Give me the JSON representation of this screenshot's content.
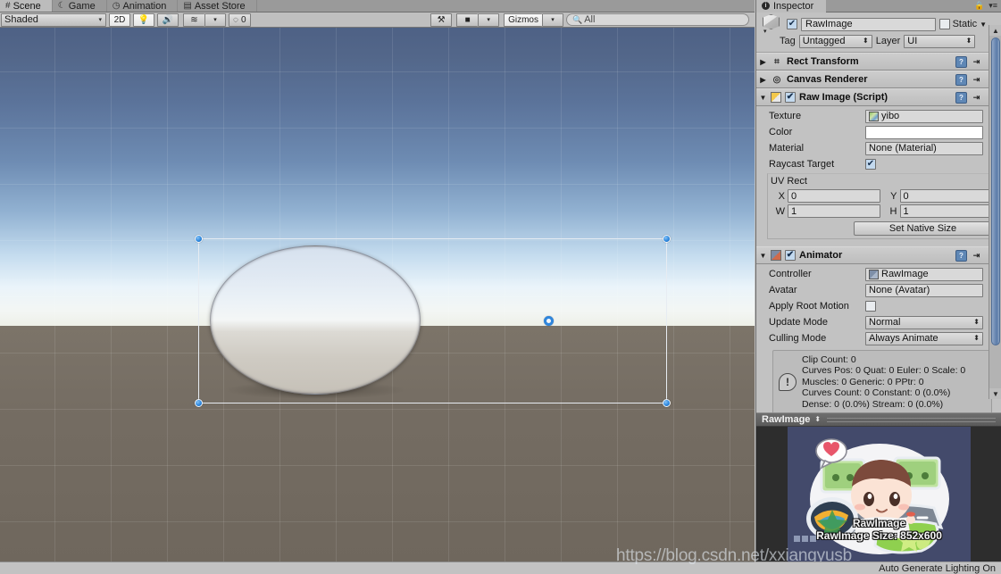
{
  "window_tabs": [
    {
      "label": "Scene",
      "icon": "grid-icon",
      "active": true
    },
    {
      "label": "Game",
      "icon": "gamepad-icon",
      "active": false
    },
    {
      "label": "Animation",
      "icon": "clock-icon",
      "active": false
    },
    {
      "label": "Asset Store",
      "icon": "store-icon",
      "active": false
    }
  ],
  "scene_toolbar": {
    "draw_mode": "Shaded",
    "two_d_button": "2D",
    "lighting_icon": "lightbulb-icon",
    "audio_icon": "speaker-icon",
    "fx_icon": "fx-layers-icon",
    "hidden_count": "0",
    "hidden_icon": "eye-slash-icon",
    "tools_icon": "tools-icon",
    "camera_icon": "camera-icon",
    "gizmos_label": "Gizmos",
    "search_placeholder": "All",
    "search_value": "All",
    "search_icon": "search-icon"
  },
  "inspector": {
    "tab_label": "Inspector",
    "tab_icon": "info-icon",
    "lock_icon": "lock-icon",
    "menu_icon": "hamburger-menu-icon",
    "object": {
      "name": "RawImage",
      "enabled": true,
      "static_label": "Static",
      "static_checked": false,
      "tag_label": "Tag",
      "tag_value": "Untagged",
      "layer_label": "Layer",
      "layer_value": "UI",
      "prefab_icon": "cube-icon"
    },
    "components": [
      {
        "title": "Rect Transform",
        "icon": "rect-transform-icon",
        "expanded": false,
        "has_toggle": false
      },
      {
        "title": "Canvas Renderer",
        "icon": "canvas-renderer-icon",
        "expanded": false,
        "has_toggle": false
      },
      {
        "title": "Raw Image (Script)",
        "icon": "raw-image-icon",
        "expanded": true,
        "has_toggle": true,
        "enabled": true,
        "fields": {
          "texture_label": "Texture",
          "texture_value": "yibo",
          "color_label": "Color",
          "color_value": "#FFFFFF",
          "material_label": "Material",
          "material_value": "None (Material)",
          "raycast_label": "Raycast Target",
          "raycast_checked": true,
          "uv_rect_label": "UV Rect",
          "uv_x_label": "X",
          "uv_x_value": "0",
          "uv_y_label": "Y",
          "uv_y_value": "0",
          "uv_w_label": "W",
          "uv_w_value": "1",
          "uv_h_label": "H",
          "uv_h_value": "1",
          "set_native_size": "Set Native Size"
        }
      },
      {
        "title": "Animator",
        "icon": "animator-icon",
        "expanded": true,
        "has_toggle": true,
        "enabled": true,
        "fields": {
          "controller_label": "Controller",
          "controller_value": "RawImage",
          "avatar_label": "Avatar",
          "avatar_value": "None (Avatar)",
          "apply_root_motion_label": "Apply Root Motion",
          "apply_root_motion_checked": false,
          "update_mode_label": "Update Mode",
          "update_mode_value": "Normal",
          "culling_mode_label": "Culling Mode",
          "culling_mode_value": "Always Animate"
        },
        "info_lines": [
          "Clip Count: 0",
          "Curves Pos: 0 Quat: 0 Euler: 0 Scale: 0",
          "Muscles: 0 Generic: 0 PPtr: 0",
          "Curves Count: 0 Constant: 0 (0.0%)",
          "Dense: 0 (0.0%) Stream: 0 (0.0%)"
        ],
        "info_icon": "warning-icon"
      }
    ],
    "preview": {
      "title": "RawImage",
      "overlay_name": "RawImage",
      "size_text": "RawImage Size: 852x600"
    }
  },
  "status_bar": {
    "text": "Auto Generate Lighting On"
  },
  "watermark": {
    "text": "https://blog.csdn.net/xxiangyusb"
  },
  "scene": {
    "selection": {
      "handles": 4,
      "pivot_icon": "pivot-handle-icon"
    }
  },
  "colors": {
    "panel_bg": "#c2c2c2",
    "tab_inactive": "#9a9a9a",
    "tab_active": "#bcbcbc",
    "handle_blue": "#2f89e0",
    "scrollbar_blue": "#6f8cb4",
    "preview_bg": "#434a6b"
  }
}
